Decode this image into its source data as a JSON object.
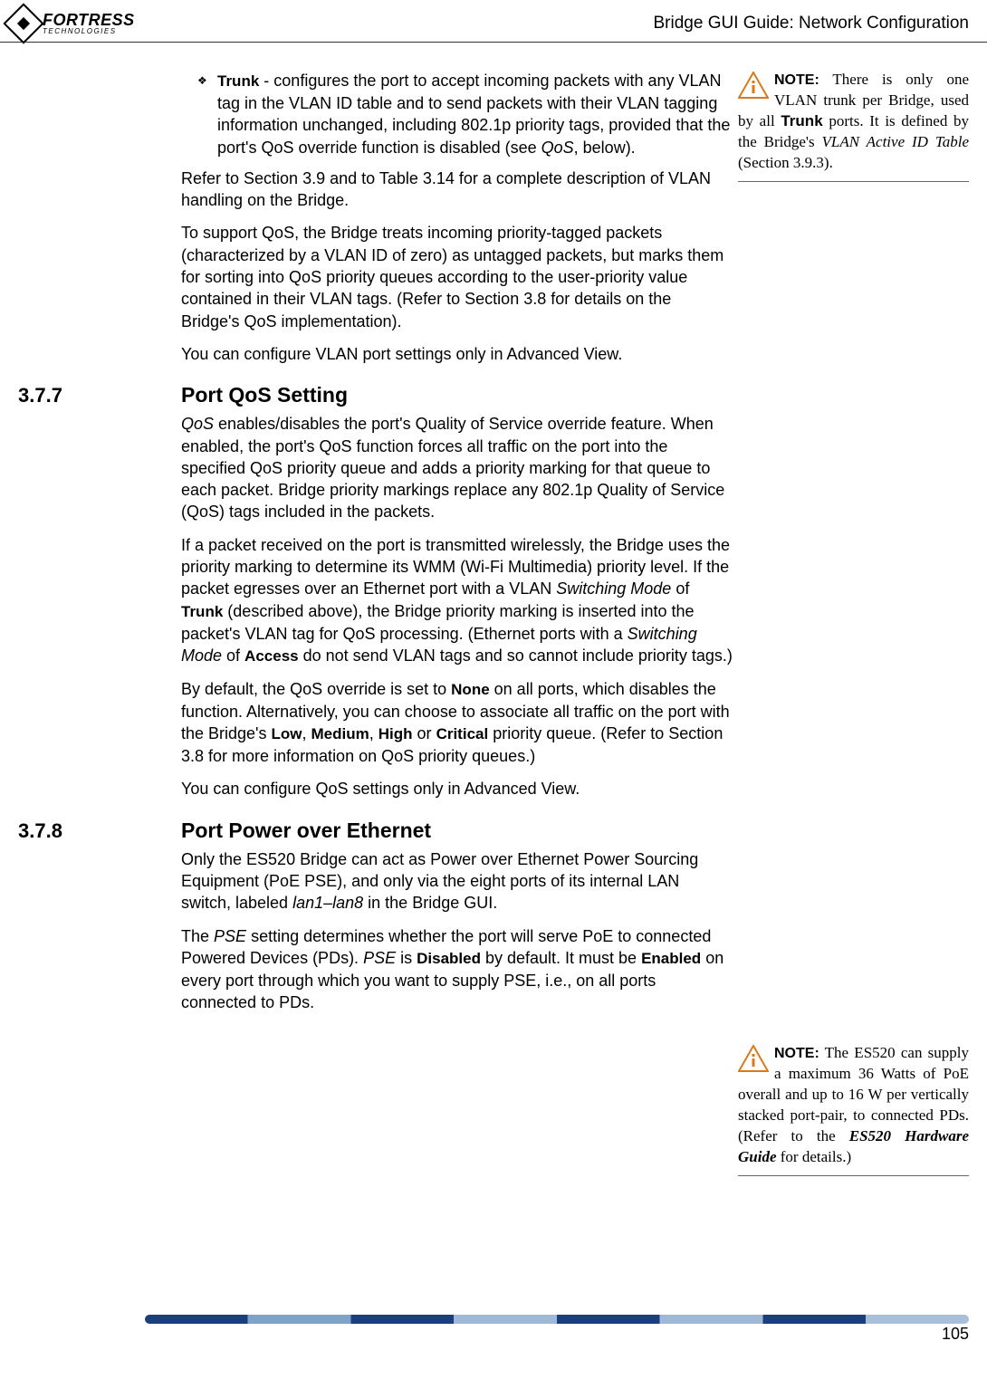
{
  "header": {
    "logo_main": "FORTRESS",
    "logo_sub": "TECHNOLOGIES",
    "title": "Bridge GUI Guide: Network Configuration"
  },
  "page_number": "105",
  "notes": [
    {
      "label": "NOTE:",
      "text_before_sans": " There is only one VLAN trunk per Bridge, used by all ",
      "sans1": "Trunk",
      "text_mid1": " ports. It is defined by the Bridge's ",
      "italic1": "VLAN Active ID Table",
      "text_after": " (Section 3.9.3)."
    },
    {
      "label": "NOTE:",
      "text_start": " The ES520 can supply a maximum 36 Watts of PoE overall and up to 16 W per vertically stacked port-pair, to connected PDs. (Refer to the ",
      "bolditalic1": "ES520 Hardware Guide",
      "text_end": " for details.)"
    }
  ],
  "body": {
    "bullet_term": "Trunk",
    "bullet_text_after": " - configures the port to accept incoming packets with any VLAN tag in the VLAN ID table and to send packets with their VLAN tagging information unchanged, including 802.1p priority tags, provided that the port's QoS override function is disabled (see ",
    "bullet_italic": "QoS",
    "bullet_tail": ", below).",
    "p1": "Refer to Section 3.9 and to Table 3.14 for a complete description of VLAN handling on the Bridge.",
    "p2": "To support QoS, the Bridge treats incoming priority-tagged packets (characterized by a VLAN ID of zero) as untagged packets, but marks them for sorting into QoS priority queues according to the user-priority value contained in their VLAN tags. (Refer to Section 3.8 for details on the Bridge's QoS implementation).",
    "p3": "You can configure VLAN port settings only in Advanced View.",
    "s377_num": "3.7.7",
    "s377_title": "Port QoS Setting",
    "p4_i1": "QoS",
    "p4_a": " enables/disables the port's Quality of Service override feature. When enabled, the port's QoS function forces all traffic on the port into the specified QoS priority queue and adds a priority marking for that queue to each packet. Bridge priority markings replace any 802.1p Quality of Service (QoS) tags included in the packets.",
    "p5_a": "If a packet received on the port is transmitted wirelessly, the Bridge uses the priority marking to determine its WMM (Wi-Fi Multimedia) priority level. If the packet egresses over an Ethernet port with a VLAN ",
    "p5_i1": "Switching Mode",
    "p5_b": " of ",
    "p5_s1": "Trunk",
    "p5_c": " (described above), the Bridge priority marking is inserted into the packet's VLAN tag for QoS processing. (Ethernet ports with a ",
    "p5_i2": "Switching Mode",
    "p5_d": " of ",
    "p5_s2": "Access",
    "p5_e": " do not send VLAN tags and so cannot include priority tags.)",
    "p6_a": "By default, the QoS override is set to ",
    "p6_s1": "None",
    "p6_b": " on all ports, which disables the function. Alternatively, you can choose to associate all traffic on the port with the Bridge's ",
    "p6_s2": "Low",
    "p6_c": ", ",
    "p6_s3": "Medium",
    "p6_d": ", ",
    "p6_s4": "High",
    "p6_e": " or ",
    "p6_s5": "Critical",
    "p6_f": " priority queue. (Refer to Section 3.8 for more information on QoS priority queues.)",
    "p7": "You can configure QoS settings only in Advanced View.",
    "s378_num": "3.7.8",
    "s378_title": "Port Power over Ethernet",
    "p8_a": "Only the ES520 Bridge can act as Power over Ethernet Power Sourcing Equipment (PoE PSE), and only via the eight ports of its internal LAN switch, labeled ",
    "p8_i1": "lan1",
    "p8_b": "–",
    "p8_i2": "lan8",
    "p8_c": " in the Bridge GUI.",
    "p9_a": "The ",
    "p9_i1": "PSE",
    "p9_b": " setting determines whether the port will serve PoE to connected Powered Devices (PDs). ",
    "p9_i2": "PSE",
    "p9_c": " is ",
    "p9_s1": "Disabled",
    "p9_d": " by default. It must be ",
    "p9_s2": "Enabled",
    "p9_e": " on every port through which you want to supply PSE, i.e., on all ports connected to PDs."
  }
}
